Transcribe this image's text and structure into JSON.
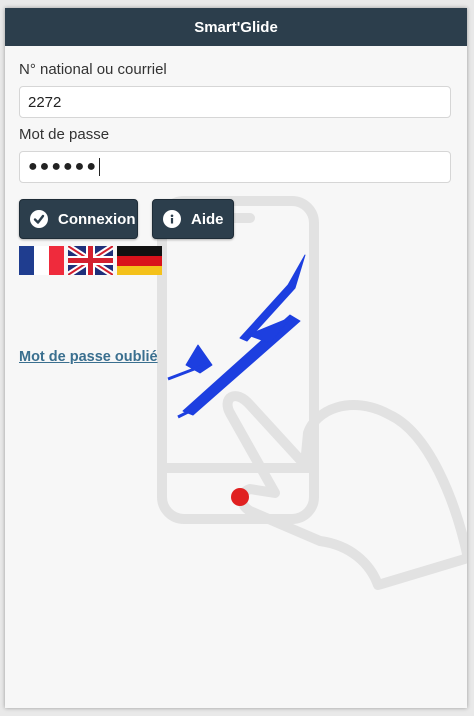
{
  "header": {
    "title": "Smart'Glide"
  },
  "form": {
    "login_label": "N° national ou courriel",
    "login_value": "2272",
    "password_label": "Mot de passe",
    "password_mask": "●●●●●●"
  },
  "buttons": {
    "login": "Connexion",
    "help": "Aide"
  },
  "languages": [
    "Français",
    "English",
    "Deutsch"
  ],
  "links": {
    "forgot_password": "Mot de passe oublié"
  },
  "colors": {
    "header_bg": "#2c3e4c",
    "link": "#3a6f8f",
    "glider": "#1d3fe0",
    "record_dot": "#e02020"
  }
}
